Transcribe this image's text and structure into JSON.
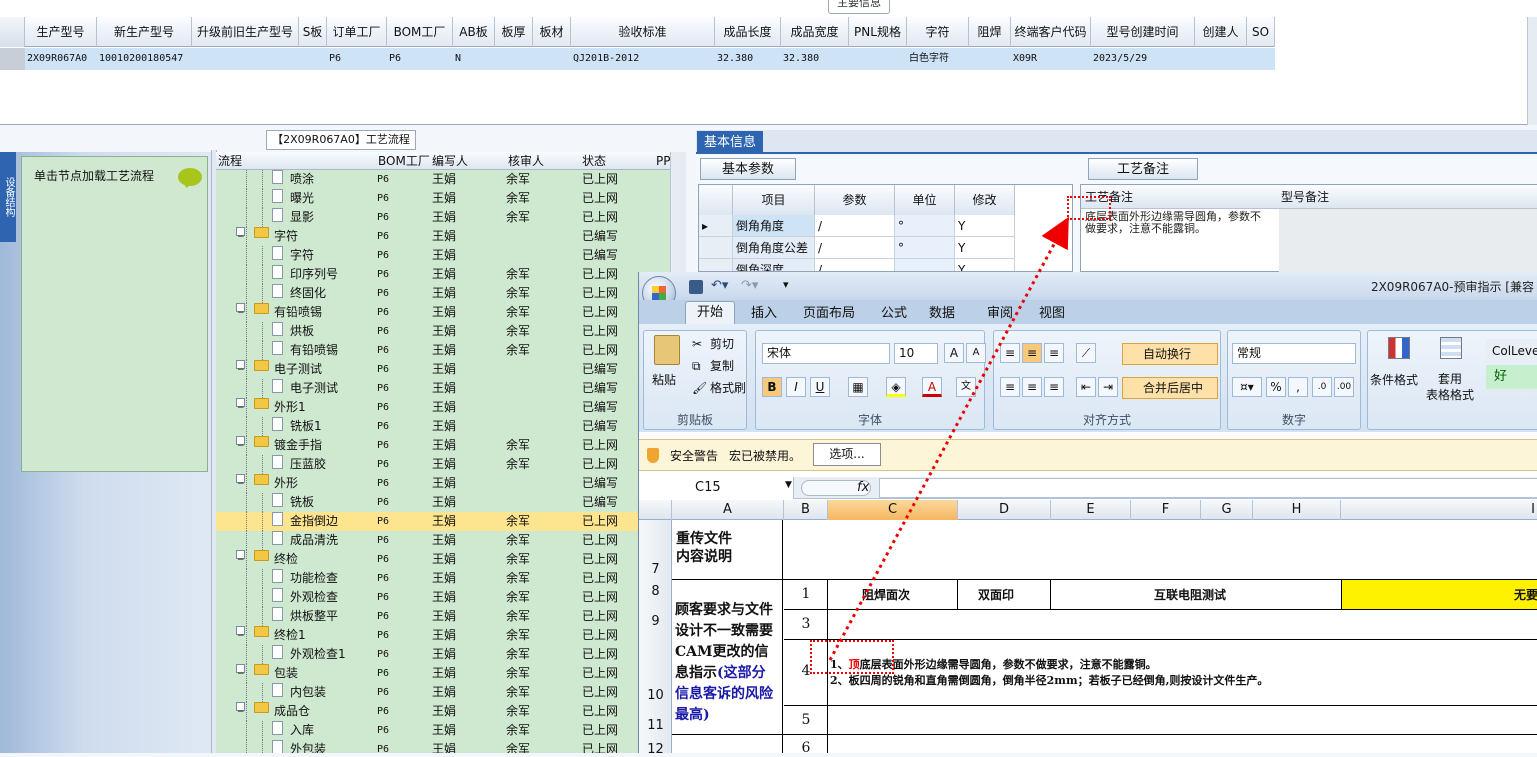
{
  "top_grid": {
    "section_title": "主要信息",
    "columns": [
      "生产型号",
      "新生产型号",
      "升级前旧生产型号",
      "S板",
      "订单工厂",
      "BOM工厂",
      "AB板",
      "板厚",
      "板材",
      "验收标准",
      "成品长度",
      "成品宽度",
      "PNL规格",
      "字符",
      "阻焊",
      "终端客户代码",
      "型号创建时间",
      "创建人",
      "SO"
    ],
    "row": [
      "2X09R067A0",
      "10010200180547",
      "",
      "",
      "P6",
      "P6",
      "N",
      "",
      "",
      "QJ201B-2012",
      "32.380",
      "32.380",
      "",
      "白色字符",
      "",
      "X09R",
      "2023/5/29",
      "",
      ""
    ]
  },
  "left_panel": {
    "vertical_tab": "设备结构",
    "node_hint": "单击节点加载工艺流程"
  },
  "process_tree": {
    "title": "【2X09R067A0】工艺流程",
    "columns": [
      "流程",
      "BOM工厂",
      "编写人",
      "核审人",
      "状态",
      "PP"
    ],
    "rows": [
      {
        "name": "喷涂",
        "type": "doc",
        "factory": "P6",
        "writer": "王娟",
        "reviewer": "余军",
        "status": "已上网"
      },
      {
        "name": "曝光",
        "type": "doc",
        "factory": "P6",
        "writer": "王娟",
        "reviewer": "余军",
        "status": "已上网"
      },
      {
        "name": "显影",
        "type": "doc",
        "factory": "P6",
        "writer": "王娟",
        "reviewer": "余军",
        "status": "已上网"
      },
      {
        "name": "字符",
        "type": "folder",
        "factory": "P6",
        "writer": "王娟",
        "reviewer": "",
        "status": "已编写"
      },
      {
        "name": "字符",
        "type": "doc",
        "factory": "P6",
        "writer": "王娟",
        "reviewer": "",
        "status": "已编写"
      },
      {
        "name": "印序列号",
        "type": "doc",
        "factory": "P6",
        "writer": "王娟",
        "reviewer": "余军",
        "status": "已上网"
      },
      {
        "name": "终固化",
        "type": "doc",
        "factory": "P6",
        "writer": "王娟",
        "reviewer": "余军",
        "status": "已上网"
      },
      {
        "name": "有铅喷锡",
        "type": "folder",
        "factory": "P6",
        "writer": "王娟",
        "reviewer": "余军",
        "status": "已上网"
      },
      {
        "name": "烘板",
        "type": "doc",
        "factory": "P6",
        "writer": "王娟",
        "reviewer": "余军",
        "status": "已上网"
      },
      {
        "name": "有铅喷锡",
        "type": "doc",
        "factory": "P6",
        "writer": "王娟",
        "reviewer": "余军",
        "status": "已上网"
      },
      {
        "name": "电子测试",
        "type": "folder",
        "factory": "P6",
        "writer": "王娟",
        "reviewer": "",
        "status": "已编写"
      },
      {
        "name": "电子测试",
        "type": "doc",
        "factory": "P6",
        "writer": "王娟",
        "reviewer": "",
        "status": "已编写"
      },
      {
        "name": "外形1",
        "type": "folder",
        "factory": "P6",
        "writer": "王娟",
        "reviewer": "",
        "status": "已编写"
      },
      {
        "name": "铣板1",
        "type": "doc",
        "factory": "P6",
        "writer": "王娟",
        "reviewer": "",
        "status": "已编写"
      },
      {
        "name": "镀金手指",
        "type": "folder",
        "factory": "P6",
        "writer": "王娟",
        "reviewer": "余军",
        "status": "已上网"
      },
      {
        "name": "压蓝胶",
        "type": "doc",
        "factory": "P6",
        "writer": "王娟",
        "reviewer": "余军",
        "status": "已上网"
      },
      {
        "name": "外形",
        "type": "folder",
        "factory": "P6",
        "writer": "王娟",
        "reviewer": "",
        "status": "已编写"
      },
      {
        "name": "铣板",
        "type": "doc",
        "factory": "P6",
        "writer": "王娟",
        "reviewer": "",
        "status": "已编写"
      },
      {
        "name": "金指倒边",
        "type": "doc",
        "factory": "P6",
        "writer": "王娟",
        "reviewer": "余军",
        "status": "已上网",
        "selected": true
      },
      {
        "name": "成品清洗",
        "type": "doc",
        "factory": "P6",
        "writer": "王娟",
        "reviewer": "余军",
        "status": "已上网"
      },
      {
        "name": "终检",
        "type": "folder",
        "factory": "P6",
        "writer": "王娟",
        "reviewer": "余军",
        "status": "已上网"
      },
      {
        "name": "功能检查",
        "type": "doc",
        "factory": "P6",
        "writer": "王娟",
        "reviewer": "余军",
        "status": "已上网"
      },
      {
        "name": "外观检查",
        "type": "doc",
        "factory": "P6",
        "writer": "王娟",
        "reviewer": "余军",
        "status": "已上网"
      },
      {
        "name": "烘板整平",
        "type": "doc",
        "factory": "P6",
        "writer": "王娟",
        "reviewer": "余军",
        "status": "已上网"
      },
      {
        "name": "终检1",
        "type": "folder",
        "factory": "P6",
        "writer": "王娟",
        "reviewer": "余军",
        "status": "已上网"
      },
      {
        "name": "外观检查1",
        "type": "doc",
        "factory": "P6",
        "writer": "王娟",
        "reviewer": "余军",
        "status": "已上网"
      },
      {
        "name": "包装",
        "type": "folder",
        "factory": "P6",
        "writer": "王娟",
        "reviewer": "余军",
        "status": "已上网"
      },
      {
        "name": "内包装",
        "type": "doc",
        "factory": "P6",
        "writer": "王娟",
        "reviewer": "余军",
        "status": "已上网"
      },
      {
        "name": "成品仓",
        "type": "folder",
        "factory": "P6",
        "writer": "王娟",
        "reviewer": "余军",
        "status": "已上网"
      },
      {
        "name": "入库",
        "type": "doc",
        "factory": "P6",
        "writer": "王娟",
        "reviewer": "余军",
        "status": "已上网"
      },
      {
        "name": "外包装",
        "type": "doc",
        "factory": "P6",
        "writer": "王娟",
        "reviewer": "余军",
        "status": "已上网"
      }
    ]
  },
  "basic_info": {
    "tab": "基本信息",
    "param_tab": "基本参数",
    "note_tab": "工艺备注",
    "param_columns": [
      "项目",
      "参数",
      "单位",
      "修改"
    ],
    "param_rows": [
      [
        "倒角角度",
        "/",
        "°",
        "Y"
      ],
      [
        "倒角角度公差",
        "/",
        "°",
        "Y"
      ],
      [
        "倒角深度",
        "/",
        "",
        "Y"
      ]
    ],
    "note_columns": [
      "工艺备注",
      "型号备注"
    ],
    "note_text": "底层表面外形边缘需导圆角，参数不做要求，注意不能露铜。"
  },
  "excel": {
    "title": "2X09R067A0-预审指示 [兼容",
    "tabs": [
      "开始",
      "插入",
      "页面布局",
      "公式",
      "数据",
      "审阅",
      "视图"
    ],
    "clipboard": {
      "paste": "粘贴",
      "cut": "剪切",
      "copy": "复制",
      "format_painter": "格式刷",
      "label": "剪贴板"
    },
    "font": {
      "name": "宋体",
      "size": "10",
      "label": "字体"
    },
    "align": {
      "wrap": "自动换行",
      "merge": "合并后居中",
      "label": "对齐方式"
    },
    "number": {
      "format": "常规",
      "label": "数字"
    },
    "styles": {
      "cond": "条件格式",
      "table": "套用\n表格格式",
      "colle": "ColLeve",
      "good": "好"
    },
    "security": {
      "label": "安全警告",
      "message": "宏已被禁用。",
      "button": "选项..."
    },
    "name_box": "C15",
    "columns": [
      "A",
      "B",
      "C",
      "D",
      "E",
      "F",
      "G",
      "H",
      "I"
    ],
    "rows": [
      "7",
      "8",
      "9",
      "10",
      "11",
      "12"
    ],
    "a7": "重传文件\n内容说明",
    "a8_main": "顾客要求与文件设计不一致需要CAM更改的信息指示",
    "a8_blue": "(这部分信息客诉的风险最高)",
    "b_nums": [
      "1",
      "3",
      "4",
      "5",
      "6"
    ],
    "r8": [
      "阻焊面次",
      "双面印",
      "互联电阻测试",
      "无要"
    ],
    "item1_prefix": "1、",
    "item1_red": "顶",
    "item1_rest": "底层表面外形边缘需导圆角，参数不做要求，注意不能露铜。",
    "item2": "2、板四周的锐角和直角需倒圆角，倒角半径2mm；若板子已经倒角,则按设计文件生产。"
  }
}
